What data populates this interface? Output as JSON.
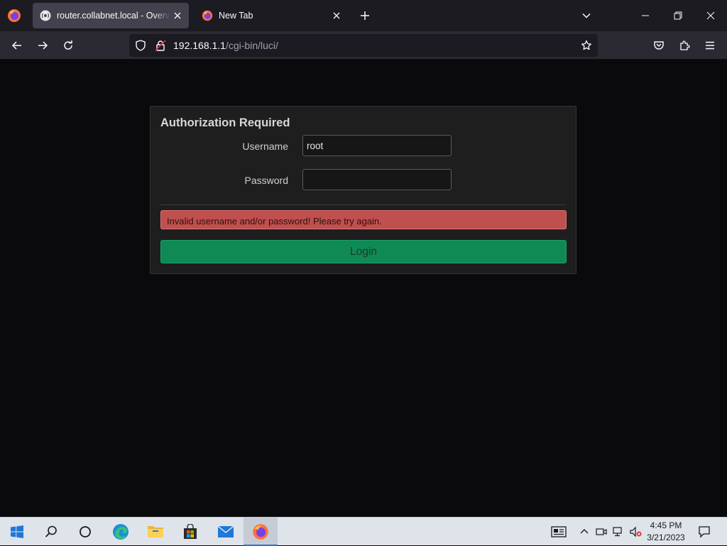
{
  "browser": {
    "tabs": [
      {
        "title": "router.collabnet.local - Overview",
        "active": true,
        "icon": "router-favicon"
      },
      {
        "title": "New Tab",
        "active": false,
        "icon": "firefox-favicon"
      }
    ],
    "url": {
      "host": "192.168.1.1",
      "path": "/cgi-bin/luci/"
    }
  },
  "login": {
    "title": "Authorization Required",
    "username_label": "Username",
    "username_value": "root",
    "password_label": "Password",
    "password_value": "",
    "error_message": "Invalid username and/or password! Please try again.",
    "login_button": "Login"
  },
  "taskbar": {
    "apps": [
      "start-icon",
      "search-icon",
      "task-view-icon",
      "edge-icon",
      "file-explorer-icon",
      "store-icon",
      "mail-icon",
      "firefox-icon"
    ],
    "clock": {
      "time": "4:45 PM",
      "date": "3/21/2023"
    }
  },
  "colors": {
    "page_bg": "#0a0a0c",
    "card_bg": "#1e1e1e",
    "alert_bg": "#c0504f",
    "login_bg": "#0f8a55"
  }
}
